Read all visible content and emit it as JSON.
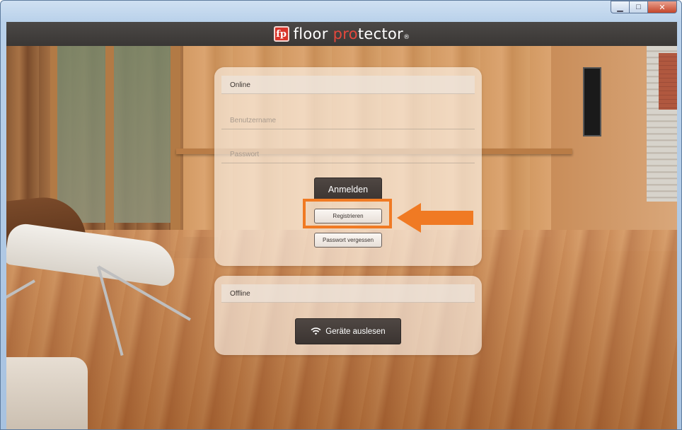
{
  "app": {
    "logo_letters": "fp",
    "brand_part1": "floor ",
    "brand_highlight": "pro",
    "brand_part2": "tector",
    "brand_mark": "®"
  },
  "window_controls": [
    "minimize",
    "maximize",
    "close"
  ],
  "online": {
    "header": "Online",
    "username_placeholder": "Benutzername",
    "username_value": "",
    "password_placeholder": "Passwort",
    "password_value": "",
    "login_label": "Anmelden",
    "register_label": "Registrieren",
    "forgot_label": "Passwort vergessen"
  },
  "offline": {
    "header": "Offline",
    "read_devices_label": "Geräte auslesen",
    "read_devices_icon": "wifi-icon"
  },
  "annotation": {
    "highlight_color": "#f07a23",
    "target": "Registrieren"
  },
  "colors": {
    "brand_red": "#d9352b",
    "button_dark": "#3b3431",
    "accent_orange": "#f07a23"
  }
}
